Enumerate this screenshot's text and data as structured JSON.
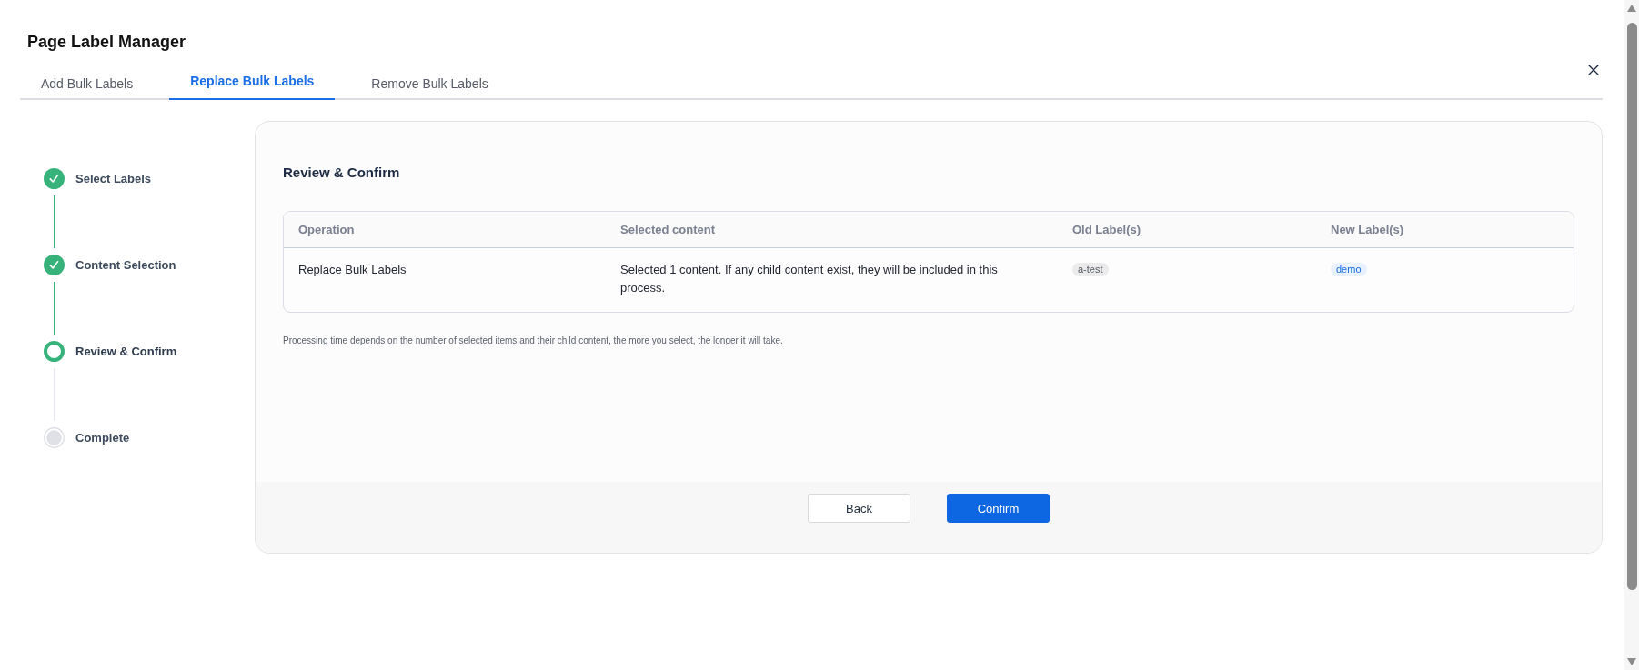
{
  "window": {
    "title": "Page Label Manager"
  },
  "tabs": [
    {
      "label": "Add Bulk Labels",
      "selected": false
    },
    {
      "label": "Replace Bulk Labels",
      "selected": true
    },
    {
      "label": "Remove Bulk Labels",
      "selected": false
    }
  ],
  "steps": [
    {
      "label": "Select Labels",
      "done": true,
      "active": false
    },
    {
      "label": "Content Selection",
      "done": true,
      "active": false
    },
    {
      "label": "Review & Confirm",
      "done": false,
      "active": true
    },
    {
      "label": "Complete",
      "done": false,
      "active": false
    }
  ],
  "review": {
    "heading": "Review & Confirm",
    "table": {
      "columns": [
        "Operation",
        "Selected content",
        "Old Label(s)",
        "New Label(s)"
      ],
      "rows": [
        {
          "operation": "Replace Bulk Labels",
          "selected_content": "Selected 1 content. If any child content exist, they will be included in this process.",
          "old_labels": [
            "a-test"
          ],
          "new_labels": [
            "demo"
          ]
        }
      ]
    },
    "note": "Processing time depends on the number of selected items and their child content, the more you select, the longer it will take."
  },
  "buttons": [
    {
      "label": "Back",
      "kind": "secondary"
    },
    {
      "label": "Confirm",
      "kind": "primary"
    }
  ]
}
